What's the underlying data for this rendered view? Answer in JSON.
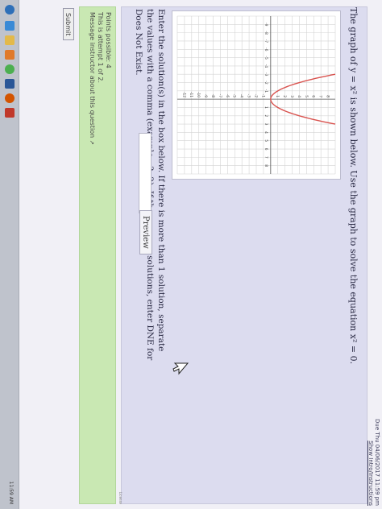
{
  "header": {
    "due": "Due Thu 04/06/2017 11:59 pm",
    "show_intro": "Show Intro/Instructions"
  },
  "question": {
    "prompt": "The graph of y = x² is shown below. Use the graph to solve the equation x² = 0.",
    "instructions": "Enter the solution(s) in the box below. If there is more than 1 solution, separate the values with a comma (example: -3, 2). If there are no solutions, enter DNE for Does Not Exist.",
    "answer_value": "",
    "preview_label": "Preview"
  },
  "graph": {
    "x_ticks": [
      "-9",
      "-8",
      "-7",
      "-6",
      "-5",
      "-4",
      "-3",
      "-2",
      "-1",
      "1",
      "2",
      "3",
      "4",
      "5",
      "6",
      "7",
      "8"
    ],
    "y_ticks": [
      "8",
      "7",
      "6",
      "5",
      "4",
      "3",
      "2",
      "1",
      "-1",
      "-2",
      "-3",
      "-4",
      "-5",
      "-6",
      "-7",
      "-8",
      "-9",
      "-10",
      "-11",
      "-12"
    ],
    "x_range": [
      -10,
      9
    ],
    "y_range": [
      -13,
      9
    ],
    "curve": "y = x^2",
    "curve_color": "#d9534f",
    "grid": true
  },
  "points": {
    "possible": "Points possible: 4",
    "attempt": "This is attempt 1 of 2.",
    "message": "Message instructor about this question"
  },
  "submit_label": "Submit",
  "license": "License",
  "taskbar": {
    "clock": "11:59 AM",
    "icons": [
      "start-icon",
      "ie-icon",
      "folder-icon",
      "media-icon",
      "chrome-icon",
      "word-icon",
      "firefox-icon",
      "app-icon"
    ]
  }
}
